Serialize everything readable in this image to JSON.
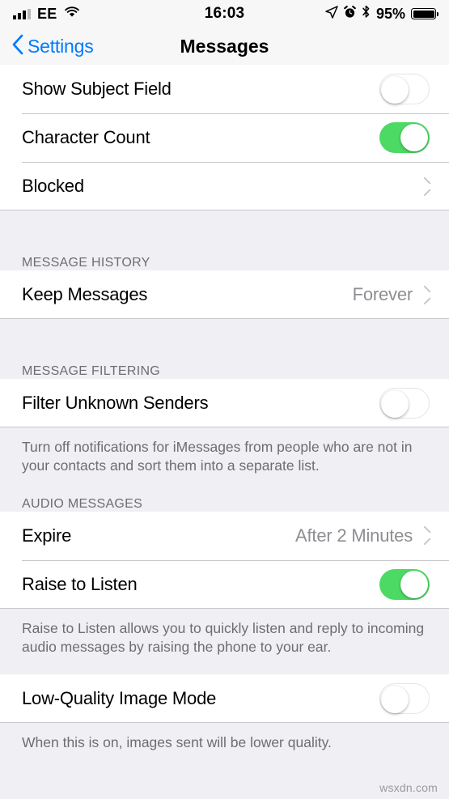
{
  "status_bar": {
    "carrier": "EE",
    "time": "16:03",
    "battery_percent": "95%",
    "icons": [
      "signal-bars-icon",
      "wifi-icon",
      "location-arrow-icon",
      "alarm-clock-icon",
      "bluetooth-icon",
      "battery-icon"
    ]
  },
  "nav": {
    "back_label": "Settings",
    "title": "Messages",
    "back_icon": "chevron-left-icon",
    "accent_color": "#007aff"
  },
  "colors": {
    "toggle_on": "#4cd964",
    "background": "#efeff4",
    "cell": "#ffffff",
    "value_text": "#8e8e93",
    "header_text": "#6d6d72",
    "separator": "#c8c7cc"
  },
  "sections": [
    {
      "header": "",
      "rows": [
        {
          "label": "Show Subject Field",
          "control": "toggle",
          "state": "off"
        },
        {
          "label": "Character Count",
          "control": "toggle",
          "state": "on"
        },
        {
          "label": "Blocked",
          "control": "chevron",
          "value": ""
        }
      ],
      "footer": ""
    },
    {
      "header": "MESSAGE HISTORY",
      "rows": [
        {
          "label": "Keep Messages",
          "control": "chevron",
          "value": "Forever"
        }
      ],
      "footer": ""
    },
    {
      "header": "MESSAGE FILTERING",
      "rows": [
        {
          "label": "Filter Unknown Senders",
          "control": "toggle",
          "state": "off"
        }
      ],
      "footer": "Turn off notifications for iMessages from people who are not in your contacts and sort them into a separate list."
    },
    {
      "header": "AUDIO MESSAGES",
      "rows": [
        {
          "label": "Expire",
          "control": "chevron",
          "value": "After 2 Minutes"
        },
        {
          "label": "Raise to Listen",
          "control": "toggle",
          "state": "on"
        }
      ],
      "footer": "Raise to Listen allows you to quickly listen and reply to incoming audio messages by raising the phone to your ear."
    },
    {
      "header": "",
      "rows": [
        {
          "label": "Low-Quality Image Mode",
          "control": "toggle",
          "state": "off"
        }
      ],
      "footer": "When this is on, images sent will be lower quality."
    }
  ],
  "watermark": "wsxdn.com"
}
